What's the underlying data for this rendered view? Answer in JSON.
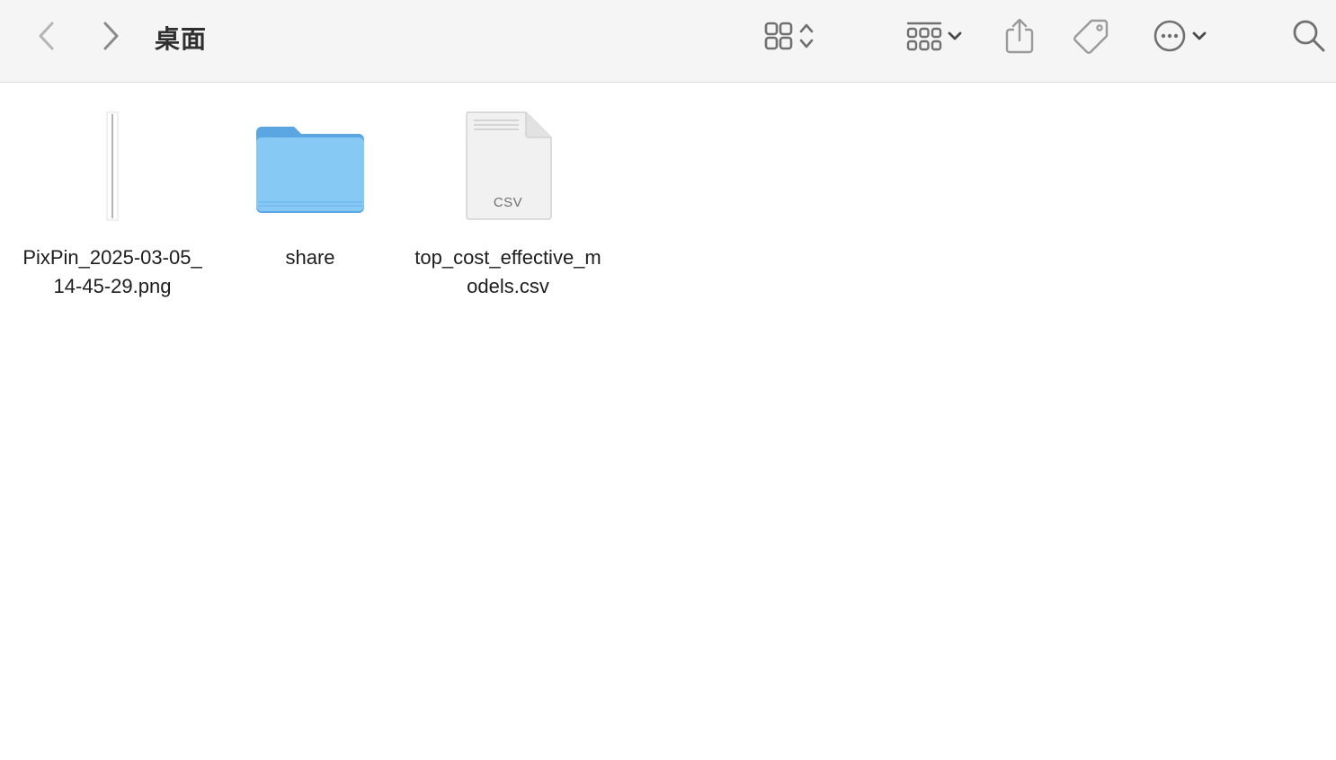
{
  "window": {
    "title": "桌面"
  },
  "toolbar": {
    "back_icon": "chevron-left-icon",
    "forward_icon": "chevron-right-icon",
    "view_icon": "icon-grid-icon",
    "group_icon": "group-by-icon",
    "share_icon": "share-icon",
    "tag_icon": "tag-icon",
    "more_icon": "ellipsis-circle-icon",
    "search_icon": "search-icon"
  },
  "files": [
    {
      "name": "PixPin_2025-03-05_14-45-29.png",
      "kind": "image-thumbnail"
    },
    {
      "name": "share",
      "kind": "folder"
    },
    {
      "name": "top_cost_effective_models.csv",
      "kind": "csv-document",
      "badge": "CSV"
    }
  ],
  "colors": {
    "toolbar_bg": "#f4f5f4",
    "icon_gray": "#8a8a8a",
    "folder_blue": "#7ec5f3",
    "folder_blue_dark": "#5aa6e3"
  }
}
